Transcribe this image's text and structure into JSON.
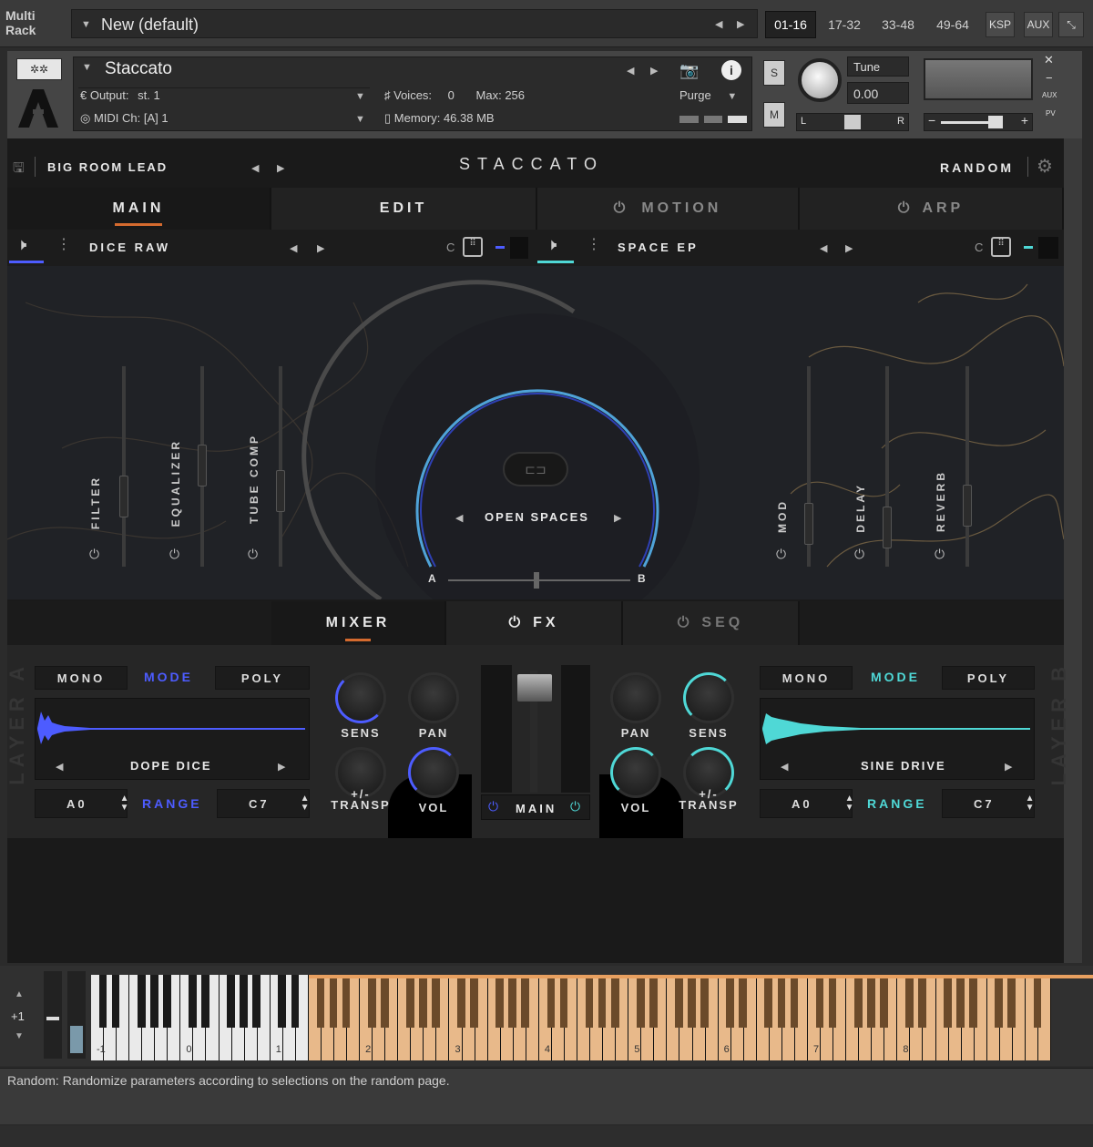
{
  "rack": {
    "label_line1": "Multi",
    "label_line2": "Rack",
    "preset": "New (default)",
    "tabs": [
      "01-16",
      "17-32",
      "33-48",
      "49-64",
      "KSP",
      "AUX"
    ],
    "active_tab": "01-16"
  },
  "instrument": {
    "name": "Staccato",
    "output_label": "Output:",
    "output_value": "st. 1",
    "midi_label": "MIDI Ch:",
    "midi_value": "[A]  1",
    "voices_label": "Voices:",
    "voices_value": "0",
    "max_label": "Max:",
    "max_value": "256",
    "memory_label": "Memory:",
    "memory_value": "46.38 MB",
    "purge": "Purge",
    "solo": "S",
    "mute": "M",
    "tune_label": "Tune",
    "tune_value": "0.00",
    "pan_left": "L",
    "pan_right": "R",
    "aux": "AUX",
    "pv": "PV"
  },
  "ui": {
    "preset_name": "BIG ROOM LEAD",
    "title": "STACCATO",
    "random": "RANDOM",
    "tabs": [
      {
        "label": "MAIN"
      },
      {
        "label": "EDIT"
      },
      {
        "label": "MOTION"
      },
      {
        "label": "ARP"
      }
    ],
    "layer_a_preset": "DICE RAW",
    "layer_b_preset": "SPACE EP",
    "c_label": "C",
    "fx_left": [
      "FILTER",
      "EQUALIZER",
      "TUBE COMP"
    ],
    "fx_right": [
      "MOD",
      "DELAY",
      "REVERB"
    ],
    "space_name": "OPEN SPACES",
    "ab_a": "A",
    "ab_b": "B"
  },
  "mixer": {
    "tabs": [
      "MIXER",
      "FX",
      "SEQ"
    ],
    "layer_a": {
      "side_label": "LAYER A",
      "mono": "MONO",
      "mode": "MODE",
      "poly": "POLY",
      "sample": "DOPE DICE",
      "range_low": "A0",
      "range": "RANGE",
      "range_high": "C7"
    },
    "layer_b": {
      "side_label": "LAYER B",
      "mono": "MONO",
      "mode": "MODE",
      "poly": "POLY",
      "sample": "SINE DRIVE",
      "range_low": "A0",
      "range": "RANGE",
      "range_high": "C7"
    },
    "knobs": {
      "sens": "SENS",
      "pan": "PAN",
      "transp": "+/-\nTRANSP",
      "vol": "VOL"
    },
    "main": "MAIN"
  },
  "keyboard": {
    "octave": "+1",
    "octave_labels": [
      "-1",
      "0",
      "1",
      "2",
      "3",
      "4",
      "5",
      "6",
      "7",
      "8"
    ]
  },
  "status": "Random: Randomize parameters according to selections on the random page.",
  "colors": {
    "accent_orange": "#d46a2e",
    "layer_a_blue": "#4d5cff",
    "layer_b_teal": "#4fd8d6",
    "key_range": "#e8b98a"
  }
}
